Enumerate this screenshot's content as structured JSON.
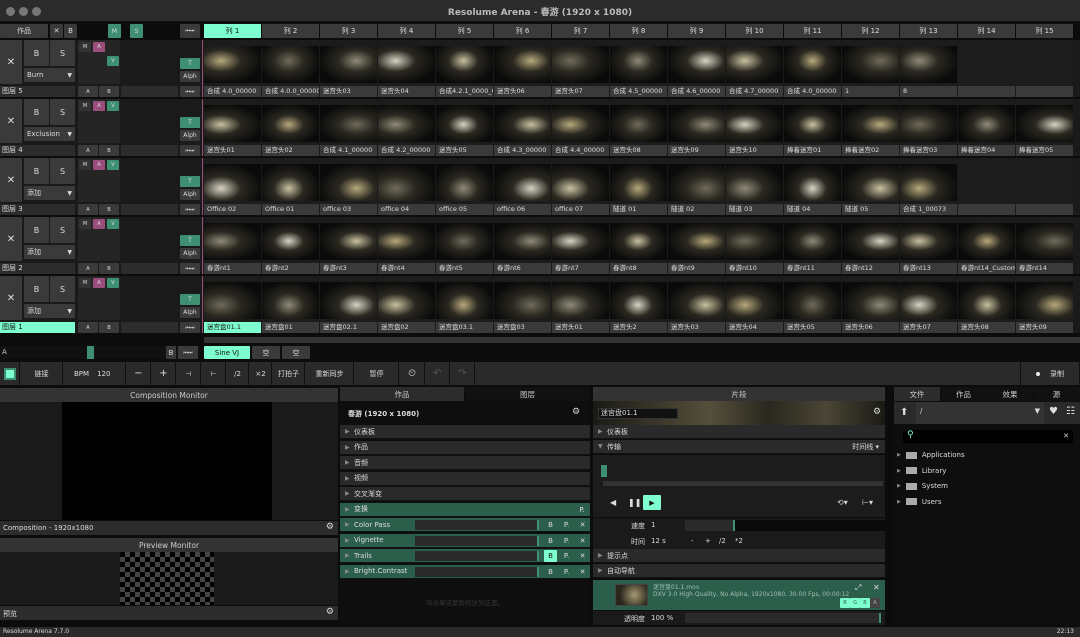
{
  "window": {
    "title": "Resolume Arena - 春游 (1920 x 1080)"
  },
  "header": {
    "comp_label": "作品",
    "x": "✕",
    "b": "B",
    "m": "M",
    "s": "S",
    "nav": "⏮⏭"
  },
  "columns": [
    "列 1",
    "列 2",
    "列 3",
    "列 4",
    "列 5",
    "列 6",
    "列 7",
    "列 8",
    "列 9",
    "列 10",
    "列 11",
    "列 12",
    "列 13",
    "列 14",
    "列 15"
  ],
  "selected_column": 0,
  "layers": [
    {
      "name": "图层 5",
      "blend": "Burn",
      "clips": [
        "合成 4.0_00000",
        "合成 4.0.0_00000",
        "迷宫头03",
        "迷宫头04",
        "合成4.2.1_0000_0...",
        "迷宫头06",
        "迷宫头07",
        "合成 4.5_00000",
        "合成 4.6_00000",
        "合成 4.7_00000",
        "合成 4.0_00000",
        "1",
        "8",
        "",
        ""
      ]
    },
    {
      "name": "图层 4",
      "blend": "Exclusion",
      "clips": [
        "迷宫头01",
        "迷宫头02",
        "合成 4.1_00000",
        "合成 4.2_00000",
        "迷宫头05",
        "合成 4.3_00000",
        "合成 4.4_00000",
        "迷宫头08",
        "迷宫头09",
        "迷宫头10",
        "捧着迷宫01",
        "捧着迷宫02",
        "捧着迷宫03",
        "捧着迷宫04",
        "捧着迷宫05"
      ]
    },
    {
      "name": "图层 3",
      "blend": "添加",
      "clips": [
        "Office 02",
        "Office 01",
        "office 03",
        "office 04",
        "office 05",
        "office 06",
        "office 07",
        "隧道 01",
        "隧道 02",
        "隧道 03",
        "隧道 04",
        "隧道 05",
        "合成 1_00073",
        "",
        ""
      ]
    },
    {
      "name": "图层 2",
      "blend": "添加",
      "clips": [
        "春游nt1",
        "春游nt2",
        "春游nt3",
        "春游nt4",
        "春游nt5",
        "春游nt6",
        "春游nt7",
        "春游nt8",
        "春游nt9",
        "春游nt10",
        "春游nt11",
        "春游nt12",
        "春游nt13",
        "春游nt14_Custom",
        "春游nt14"
      ]
    },
    {
      "name": "图层 1",
      "blend": "添加",
      "selected": true,
      "clips": [
        "迷宫盘01.1",
        "迷宫盘01",
        "迷宫盘02.1",
        "迷宫盘02",
        "迷宫盘03.1",
        "迷宫盘03",
        "迷宫头01",
        "迷宫头2",
        "迷宫头03",
        "迷宫头04",
        "迷宫头05",
        "迷宫头06",
        "迷宫头07",
        "迷宫头08",
        "迷宫头09"
      ],
      "selected_clip": 0
    }
  ],
  "layer_buttons": {
    "clear": "✕",
    "bypass": "B",
    "solo": "S",
    "m": "M",
    "a": "A",
    "v": "V",
    "t": "T",
    "alpha": "Alph",
    "ab_a": "A",
    "ab_b": "B"
  },
  "deck": {
    "a": "A",
    "b": "B",
    "crossfader": 0.5,
    "tabs": [
      "Sine VJ",
      "空",
      "空"
    ]
  },
  "toolbar": {
    "link": "链接",
    "bpm_label": "BPM",
    "bpm": "120",
    "minus": "−",
    "plus": "+",
    "nudge_left": "⊣",
    "nudge_right": "⊢",
    "half": "/2",
    "double": "×2",
    "tap": "打拍子",
    "resync": "重新同步",
    "pause": "暂停",
    "record": "录制"
  },
  "composition_monitor": {
    "title": "Composition Monitor",
    "footer": "Composition - 1920x1080"
  },
  "preview_monitor": {
    "title": "Preview Monitor",
    "footer": "预览"
  },
  "comp_panel": {
    "tabs": [
      "作品",
      "图层"
    ],
    "title": "春游 (1920 x 1080)",
    "sections": [
      "仪表板",
      "作品",
      "音频",
      "视频",
      "交叉渐变"
    ],
    "transform": "变换",
    "effects": [
      "Color Pass",
      "Vignette",
      "Trails",
      "Bright.Contrast"
    ],
    "drop_hint": "将效果或蒙版拖放到这里。",
    "b": "B",
    "p": "P.",
    "x": "✕"
  },
  "clip_panel": {
    "title": "片段",
    "clip_name": "迷宫盘01.1",
    "dashboard": "仪表板",
    "transport": "传输",
    "timeline_mode": "时间线",
    "speed_label": "速度",
    "speed": "1",
    "time_label": "时间",
    "time": "12 s",
    "minus": "-",
    "plus": "+",
    "half": "/2",
    "double": "*2",
    "cue_points": "提示点",
    "autopilot": "自动导航",
    "file": "迷宫盘01.1.mov",
    "file_info": "DXV 3.0 High Quality, No Alpha, 1920x1080, 30.00 Fps, 00:00:12",
    "channels": [
      "R",
      "G",
      "B",
      "A"
    ],
    "opacity_label": "透明度",
    "opacity": "100 %"
  },
  "browser": {
    "tabs": [
      "文件",
      "作品",
      "效果",
      "源"
    ],
    "path": "/",
    "search_placeholder": "",
    "items": [
      "Applications",
      "Library",
      "System",
      "Users"
    ]
  },
  "status": {
    "version": "Resolume Arena 7.7.0",
    "time": "22:13"
  },
  "colors": {
    "accent": "#7effd0",
    "teal": "#3f8f73",
    "pink": "#9a4e7c"
  }
}
